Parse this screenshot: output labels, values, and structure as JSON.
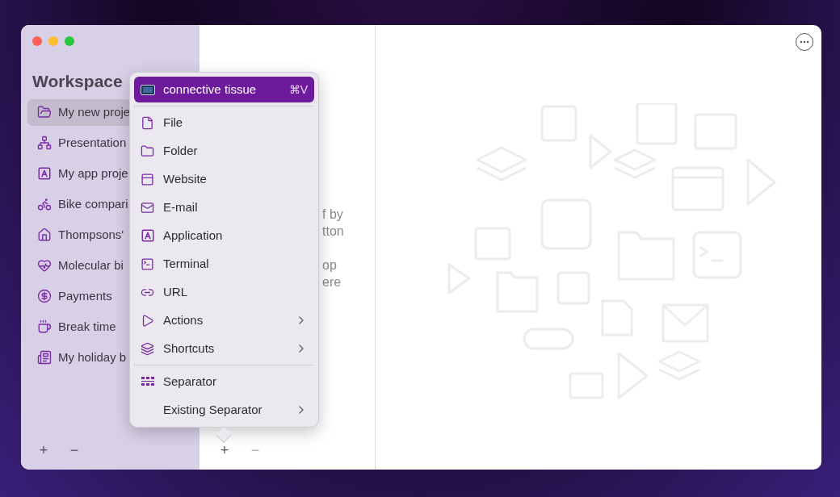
{
  "sidebar": {
    "title": "Workspace",
    "items": [
      {
        "label": "My new proje",
        "selected": true
      },
      {
        "label": "Presentation",
        "selected": false
      },
      {
        "label": "My app proje",
        "selected": false
      },
      {
        "label": "Bike compari",
        "selected": false
      },
      {
        "label": "Thompsons'",
        "selected": false
      },
      {
        "label": "Molecular bi",
        "selected": false
      },
      {
        "label": "Payments",
        "selected": false
      },
      {
        "label": "Break time",
        "selected": false
      },
      {
        "label": "My holiday b",
        "selected": false
      }
    ],
    "footer_buttons": [
      {
        "label": "+",
        "disabled": false
      },
      {
        "label": "−",
        "disabled": false
      }
    ]
  },
  "list_pane": {
    "text_fragments": [
      "f by",
      "tton",
      "op",
      "ere"
    ],
    "footer_buttons": [
      {
        "label": "+",
        "disabled": false
      },
      {
        "label": "−",
        "disabled": true
      }
    ]
  },
  "menu": {
    "sections": [
      [
        {
          "label": "connective tissue",
          "shortcut": "⌘V",
          "highlighted": true,
          "submenu": false
        }
      ],
      [
        {
          "label": "File",
          "highlighted": false,
          "submenu": false
        },
        {
          "label": "Folder",
          "highlighted": false,
          "submenu": false
        },
        {
          "label": "Website",
          "highlighted": false,
          "submenu": false
        },
        {
          "label": "E-mail",
          "highlighted": false,
          "submenu": false
        },
        {
          "label": "Application",
          "highlighted": false,
          "submenu": false
        },
        {
          "label": "Terminal",
          "highlighted": false,
          "submenu": false
        },
        {
          "label": "URL",
          "highlighted": false,
          "submenu": false
        },
        {
          "label": "Actions",
          "highlighted": false,
          "submenu": true
        },
        {
          "label": "Shortcuts",
          "highlighted": false,
          "submenu": true
        }
      ],
      [
        {
          "label": "Separator",
          "highlighted": false,
          "submenu": false
        },
        {
          "label": "Existing Separator",
          "highlighted": false,
          "submenu": true
        }
      ]
    ]
  }
}
